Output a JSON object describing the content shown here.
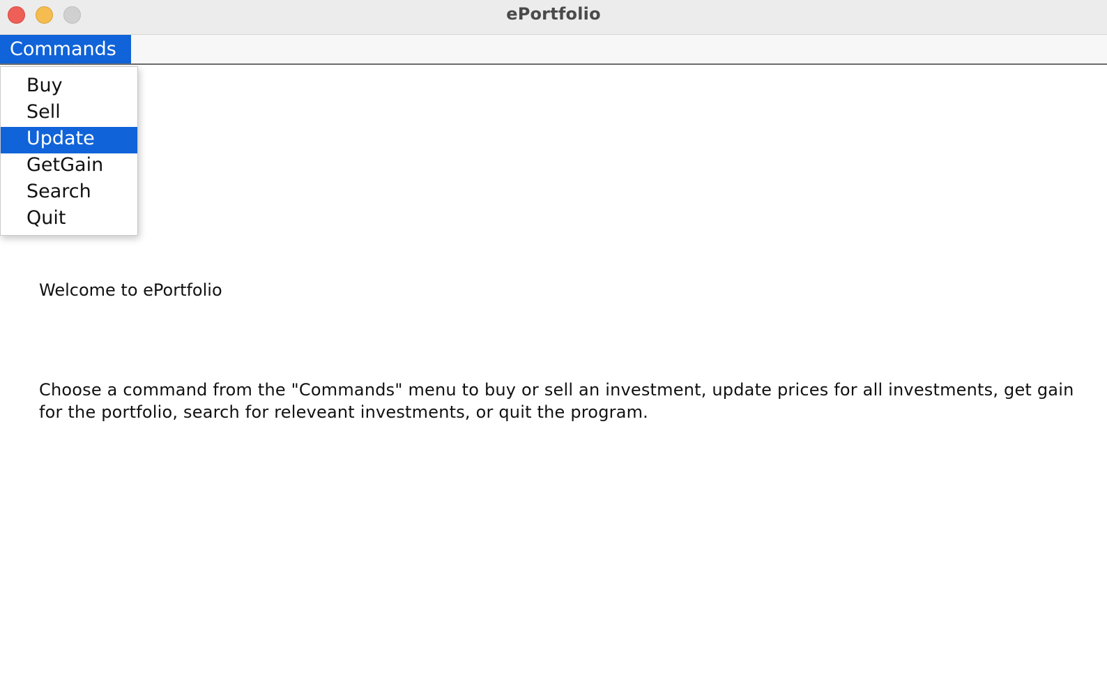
{
  "window": {
    "title": "ePortfolio"
  },
  "menubar": {
    "menu_title": "Commands"
  },
  "dropdown": {
    "items": [
      {
        "label": "Buy",
        "selected": false
      },
      {
        "label": "Sell",
        "selected": false
      },
      {
        "label": "Update",
        "selected": true
      },
      {
        "label": "GetGain",
        "selected": false
      },
      {
        "label": "Search",
        "selected": false
      },
      {
        "label": "Quit",
        "selected": false
      }
    ]
  },
  "main": {
    "welcome": "Welcome to ePortfolio",
    "description": "Choose a command from the \"Commands\" menu to buy or sell an investment, update prices for all investments, get gain for the portfolio, search for releveant investments, or quit the program."
  },
  "colors": {
    "accent": "#1063d8",
    "close": "#ee5f57",
    "minimize": "#f5bd4f",
    "zoom_inactive": "#d0d0d0"
  }
}
